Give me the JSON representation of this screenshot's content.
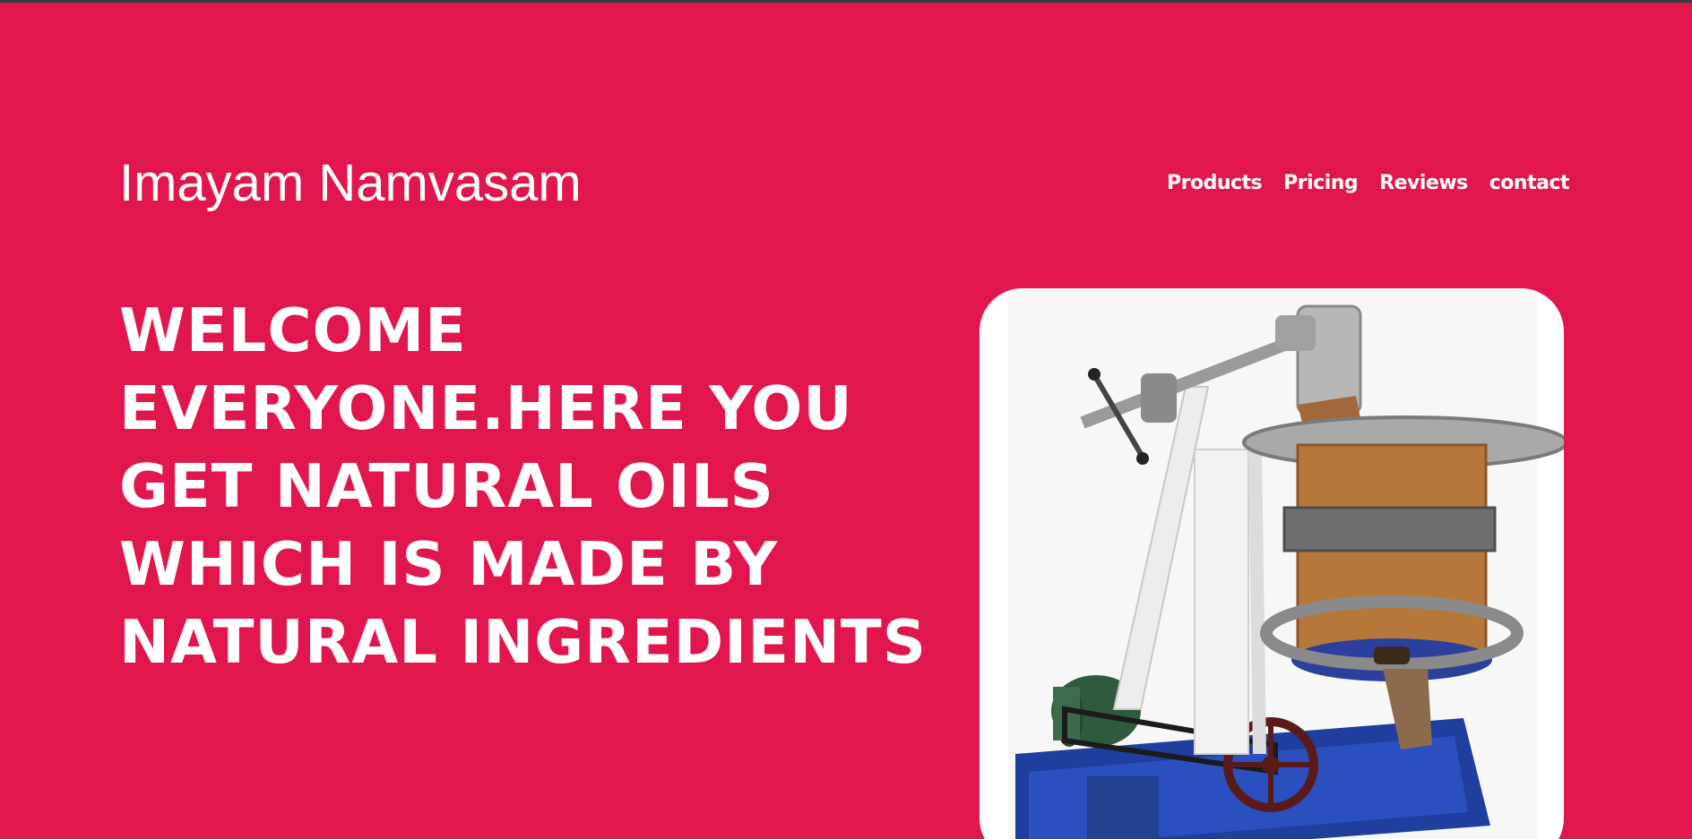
{
  "header": {
    "brand": "Imayam Namvasam",
    "nav": [
      {
        "label": "Products"
      },
      {
        "label": "Pricing"
      },
      {
        "label": "Reviews"
      },
      {
        "label": "contact"
      }
    ]
  },
  "hero": {
    "headline": "WELCOME EVERYONE.HERE YOU GET NATURAL OILS WHICH IS MADE BY NATURAL INGREDIENTS",
    "image": {
      "icon": "oil-press-machine-image"
    }
  },
  "colors": {
    "background": "#e0164c",
    "text": "#ffffff",
    "card": "#ffffff"
  }
}
